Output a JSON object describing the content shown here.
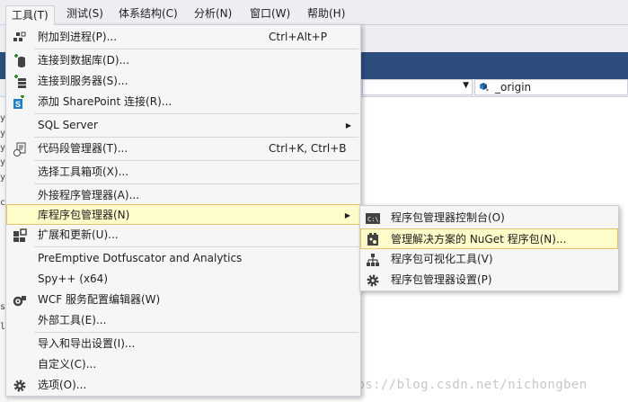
{
  "menubar": {
    "items": [
      "工具(T)",
      "测试(S)",
      "体系结构(C)",
      "分析(N)",
      "窗口(W)",
      "帮助(H)"
    ]
  },
  "editor": {
    "member_dropdown": "_origin",
    "gutter_lines": [
      "y",
      "y",
      "y",
      "y",
      "y",
      "c",
      "s",
      "l"
    ]
  },
  "tools_menu": {
    "items": [
      {
        "label": "附加到进程(P)...",
        "shortcut": "Ctrl+Alt+P",
        "icon": "attach-process-icon"
      },
      {
        "label": "连接到数据库(D)...",
        "icon": "connect-database-icon"
      },
      {
        "label": "连接到服务器(S)...",
        "icon": "connect-server-icon"
      },
      {
        "label": "添加 SharePoint 连接(R)...",
        "icon": "sharepoint-icon"
      },
      {
        "label": "SQL Server",
        "has_submenu": true
      },
      {
        "label": "代码段管理器(T)...",
        "shortcut": "Ctrl+K, Ctrl+B",
        "icon": "code-snippets-icon"
      },
      {
        "label": "选择工具箱项(X)..."
      },
      {
        "label": "外接程序管理器(A)..."
      },
      {
        "label": "库程序包管理器(N)",
        "has_submenu": true,
        "highlighted": true
      },
      {
        "label": "扩展和更新(U)...",
        "icon": "extensions-icon"
      },
      {
        "label": "PreEmptive Dotfuscator and Analytics"
      },
      {
        "label": "Spy++ (x64)"
      },
      {
        "label": "WCF 服务配置编辑器(W)",
        "icon": "wcf-config-icon"
      },
      {
        "label": "外部工具(E)..."
      },
      {
        "label": "导入和导出设置(I)..."
      },
      {
        "label": "自定义(C)..."
      },
      {
        "label": "选项(O)...",
        "icon": "gear-icon"
      }
    ]
  },
  "nuget_submenu": {
    "items": [
      {
        "label": "程序包管理器控制台(O)",
        "icon": "console-icon"
      },
      {
        "label": "管理解决方案的 NuGet 程序包(N)...",
        "icon": "nuget-package-icon",
        "highlighted": true
      },
      {
        "label": "程序包可视化工具(V)",
        "icon": "hierarchy-icon"
      },
      {
        "label": "程序包管理器设置(P)",
        "icon": "gear-icon"
      }
    ]
  },
  "watermark": "https://blog.csdn.net/nichongben",
  "colors": {
    "menu_background": "#f6f6f6",
    "highlight_fill": "#fefcc8",
    "highlight_border": "#e5c365",
    "title_bar": "#2d4d7d"
  }
}
